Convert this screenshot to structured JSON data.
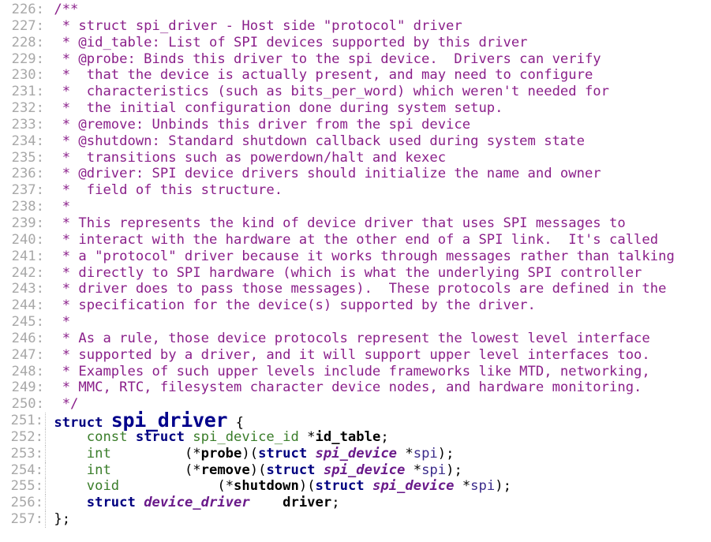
{
  "colors": {
    "comment": "#8a1f8a",
    "keyword": "#000080",
    "type": "#3a7d2a",
    "line_number": "#a8a8a8"
  },
  "lines": [
    {
      "num": "226:",
      "segs": [
        {
          "c": "cm",
          "t": "/**"
        }
      ]
    },
    {
      "num": "227:",
      "segs": [
        {
          "c": "cm",
          "t": " * struct spi_driver - Host side \"protocol\" driver"
        }
      ]
    },
    {
      "num": "228:",
      "segs": [
        {
          "c": "cm",
          "t": " * @id_table: List of SPI devices supported by this driver"
        }
      ]
    },
    {
      "num": "229:",
      "segs": [
        {
          "c": "cm",
          "t": " * @probe: Binds this driver to the spi device.  Drivers can verify"
        }
      ]
    },
    {
      "num": "230:",
      "segs": [
        {
          "c": "cm",
          "t": " *  that the device is actually present, and may need to configure"
        }
      ]
    },
    {
      "num": "231:",
      "segs": [
        {
          "c": "cm",
          "t": " *  characteristics (such as bits_per_word) which weren't needed for"
        }
      ]
    },
    {
      "num": "232:",
      "segs": [
        {
          "c": "cm",
          "t": " *  the initial configuration done during system setup."
        }
      ]
    },
    {
      "num": "233:",
      "segs": [
        {
          "c": "cm",
          "t": " * @remove: Unbinds this driver from the spi device"
        }
      ]
    },
    {
      "num": "234:",
      "segs": [
        {
          "c": "cm",
          "t": " * @shutdown: Standard shutdown callback used during system state"
        }
      ]
    },
    {
      "num": "235:",
      "segs": [
        {
          "c": "cm",
          "t": " *  transitions such as powerdown/halt and kexec"
        }
      ]
    },
    {
      "num": "236:",
      "segs": [
        {
          "c": "cm",
          "t": " * @driver: SPI device drivers should initialize the name and owner"
        }
      ]
    },
    {
      "num": "237:",
      "segs": [
        {
          "c": "cm",
          "t": " *  field of this structure."
        }
      ]
    },
    {
      "num": "238:",
      "segs": [
        {
          "c": "cm",
          "t": " *"
        }
      ]
    },
    {
      "num": "239:",
      "segs": [
        {
          "c": "cm",
          "t": " * This represents the kind of device driver that uses SPI messages to"
        }
      ]
    },
    {
      "num": "240:",
      "segs": [
        {
          "c": "cm",
          "t": " * interact with the hardware at the other end of a SPI link.  It's called"
        }
      ]
    },
    {
      "num": "241:",
      "segs": [
        {
          "c": "cm",
          "t": " * a \"protocol\" driver because it works through messages rather than talking"
        }
      ]
    },
    {
      "num": "242:",
      "segs": [
        {
          "c": "cm",
          "t": " * directly to SPI hardware (which is what the underlying SPI controller"
        }
      ]
    },
    {
      "num": "243:",
      "segs": [
        {
          "c": "cm",
          "t": " * driver does to pass those messages).  These protocols are defined in the"
        }
      ]
    },
    {
      "num": "244:",
      "segs": [
        {
          "c": "cm",
          "t": " * specification for the device(s) supported by the driver."
        }
      ]
    },
    {
      "num": "245:",
      "segs": [
        {
          "c": "cm",
          "t": " *"
        }
      ]
    },
    {
      "num": "246:",
      "segs": [
        {
          "c": "cm",
          "t": " * As a rule, those device protocols represent the lowest level interface"
        }
      ]
    },
    {
      "num": "247:",
      "segs": [
        {
          "c": "cm",
          "t": " * supported by a driver, and it will support upper level interfaces too."
        }
      ]
    },
    {
      "num": "248:",
      "segs": [
        {
          "c": "cm",
          "t": " * Examples of such upper levels include frameworks like MTD, networking,"
        }
      ]
    },
    {
      "num": "249:",
      "segs": [
        {
          "c": "cm",
          "t": " * MMC, RTC, filesystem character device nodes, and hardware monitoring."
        }
      ]
    },
    {
      "num": "250:",
      "segs": [
        {
          "c": "cm",
          "t": " */"
        }
      ]
    },
    {
      "num": "251:",
      "sep": true,
      "segs": [
        {
          "c": "kw",
          "t": "struct "
        },
        {
          "c": "big",
          "t": "spi_driver"
        },
        {
          "c": "txt",
          "t": " {"
        }
      ]
    },
    {
      "num": "252:",
      "sep": true,
      "segs": [
        {
          "c": "txt",
          "t": "    "
        },
        {
          "c": "kt",
          "t": "const "
        },
        {
          "c": "kw",
          "t": "struct "
        },
        {
          "c": "kt",
          "t": "spi_device_id "
        },
        {
          "c": "txt",
          "t": "*"
        },
        {
          "c": "id",
          "t": "id_table"
        },
        {
          "c": "txt",
          "t": ";"
        }
      ]
    },
    {
      "num": "253:",
      "sep": true,
      "segs": [
        {
          "c": "txt",
          "t": "    "
        },
        {
          "c": "kt",
          "t": "int"
        },
        {
          "c": "txt",
          "t": "         (*"
        },
        {
          "c": "id",
          "t": "probe"
        },
        {
          "c": "txt",
          "t": ")("
        },
        {
          "c": "kw",
          "t": "struct "
        },
        {
          "c": "ty",
          "t": "spi_device"
        },
        {
          "c": "txt",
          "t": " *"
        },
        {
          "c": "pt",
          "t": "spi"
        },
        {
          "c": "txt",
          "t": ");"
        }
      ]
    },
    {
      "num": "254:",
      "sep": true,
      "segs": [
        {
          "c": "txt",
          "t": "    "
        },
        {
          "c": "kt",
          "t": "int"
        },
        {
          "c": "txt",
          "t": "         (*"
        },
        {
          "c": "id",
          "t": "remove"
        },
        {
          "c": "txt",
          "t": ")("
        },
        {
          "c": "kw",
          "t": "struct "
        },
        {
          "c": "ty",
          "t": "spi_device"
        },
        {
          "c": "txt",
          "t": " *"
        },
        {
          "c": "pt",
          "t": "spi"
        },
        {
          "c": "txt",
          "t": ");"
        }
      ]
    },
    {
      "num": "255:",
      "sep": true,
      "segs": [
        {
          "c": "txt",
          "t": "    "
        },
        {
          "c": "kt",
          "t": "void"
        },
        {
          "c": "txt",
          "t": "            (*"
        },
        {
          "c": "id",
          "t": "shutdown"
        },
        {
          "c": "txt",
          "t": ")("
        },
        {
          "c": "kw",
          "t": "struct "
        },
        {
          "c": "ty",
          "t": "spi_device"
        },
        {
          "c": "txt",
          "t": " *"
        },
        {
          "c": "pt",
          "t": "spi"
        },
        {
          "c": "txt",
          "t": ");"
        }
      ]
    },
    {
      "num": "256:",
      "sep": true,
      "segs": [
        {
          "c": "txt",
          "t": "    "
        },
        {
          "c": "kw",
          "t": "struct "
        },
        {
          "c": "ty",
          "t": "device_driver"
        },
        {
          "c": "txt",
          "t": "    "
        },
        {
          "c": "id",
          "t": "driver"
        },
        {
          "c": "txt",
          "t": ";"
        }
      ]
    },
    {
      "num": "257:",
      "sep": true,
      "segs": [
        {
          "c": "txt",
          "t": "};"
        }
      ]
    }
  ]
}
